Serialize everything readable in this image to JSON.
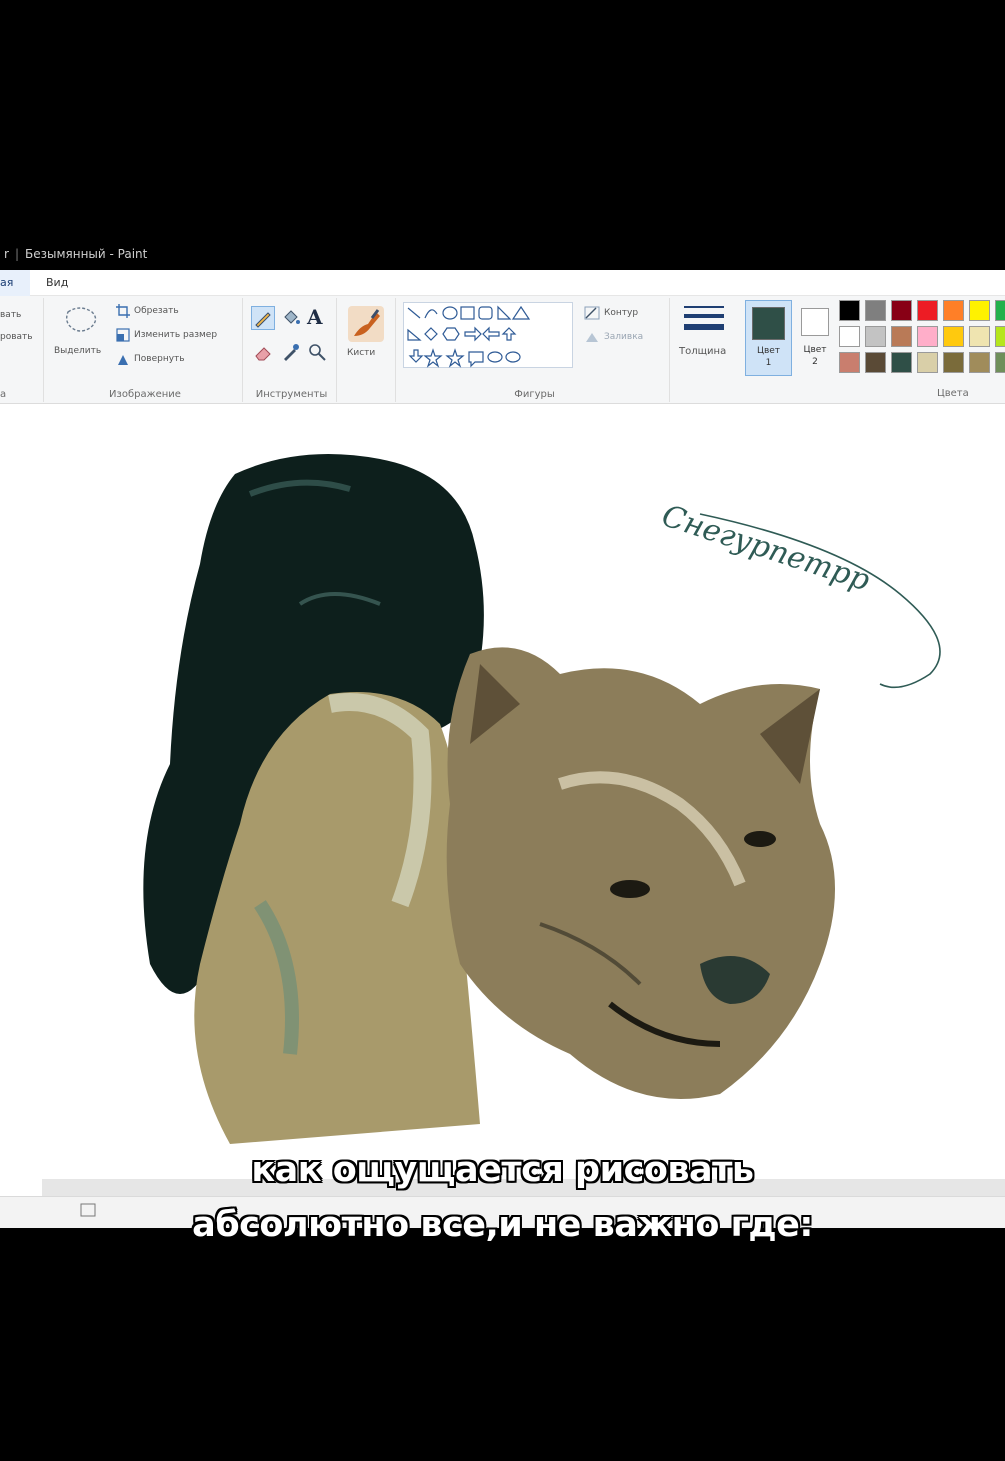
{
  "window": {
    "title_prefix": "r",
    "title": "Безымянный - Paint"
  },
  "tabs": [
    {
      "label": "ая"
    },
    {
      "label": "Вид"
    }
  ],
  "ribbon": {
    "clipboard": {
      "item1": "вать",
      "item2": "ровать",
      "label": "а"
    },
    "image": {
      "select": "Выделить",
      "crop": "Обрезать",
      "resize": "Изменить размер",
      "rotate": "Повернуть",
      "label": "Изображение"
    },
    "tools": {
      "label": "Инструменты",
      "text_tool": "A"
    },
    "brushes": {
      "label": "Кисти"
    },
    "shapes": {
      "outline": "Контур",
      "fill": "Заливка",
      "label": "Фигуры"
    },
    "size": {
      "label": "Толщина"
    },
    "color1": {
      "label_line1": "Цвет",
      "label_line2": "1",
      "color": "#2f4f47"
    },
    "color2": {
      "label_line1": "Цвет",
      "label_line2": "2",
      "color": "#ffffff"
    },
    "colors_label": "Цвета",
    "palette": [
      "#000000",
      "#7f7f7f",
      "#880015",
      "#ed1c24",
      "#ff7f27",
      "#fff200",
      "#22b14c",
      "#ffffff",
      "#c3c3c3",
      "#b97a57",
      "#ffaec9",
      "#ffc90e",
      "#efe4b0",
      "#b5e61d",
      "#c97e6e",
      "#5a4a36",
      "#2f4f47",
      "#d9cfa8",
      "#7a6b3a",
      "#a08c5b",
      "#6f8f5a"
    ]
  },
  "canvas": {
    "signature": "Снегурпетрр"
  },
  "captions": {
    "line1": "как ощущается рисовать",
    "line2": "абсолютно все,и не важно где:"
  },
  "icons": {
    "select": "lasso-select-icon",
    "crop": "crop-icon",
    "resize": "resize-icon",
    "rotate": "rotate-icon",
    "pencil": "pencil-icon",
    "fill": "fill-bucket-icon",
    "text": "text-icon",
    "eraser": "eraser-icon",
    "picker": "color-picker-icon",
    "zoom": "magnifier-icon",
    "brush": "brush-icon",
    "size": "line-thickness-icon"
  }
}
